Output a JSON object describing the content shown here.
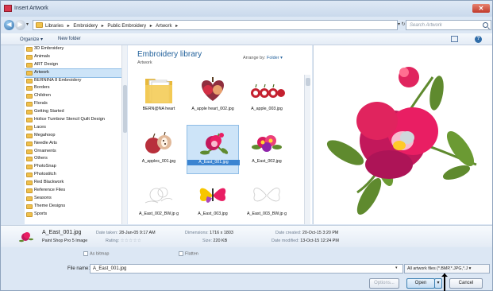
{
  "window": {
    "title": "Insert Artwork",
    "close_glyph": "✕"
  },
  "address": {
    "crumbs": [
      "Libraries",
      "▸",
      "Embroidery",
      "▸",
      "Public Embroidery",
      "▸",
      "Artwork",
      "▸"
    ],
    "dropdown_glyph": "▾",
    "refresh_glyph": "▾ ↻",
    "search_placeholder": "Search Artwork"
  },
  "toolbar": {
    "organize": "Organize ▾",
    "new_folder": "New folder",
    "help_glyph": "?"
  },
  "nav": {
    "items": [
      "3D Embroidery",
      "Animals",
      "ART Design",
      "Artwork",
      "BERNINA 8 Embroidery",
      "Borders",
      "Children",
      "Florals",
      "Getting Started",
      "Holice Turnbow Stencil Quilt Design",
      "Laces",
      "Megahoop",
      "Needle Arts",
      "Ornaments",
      "Others",
      "PhotoSnap",
      "Photostitch",
      "Red Blackwork",
      "Reference Files",
      "Seasons",
      "Theme Designs",
      "Sports"
    ],
    "selected_index": 3
  },
  "library": {
    "title": "Embroidery library",
    "subtitle": "Artwork",
    "arrange_label": "Arrange by:",
    "arrange_value": "Folder ▾"
  },
  "files": [
    {
      "label": "BERN@NA heart",
      "icon": "folder-icon"
    },
    {
      "label": "A_apple heart_002.jpg",
      "icon": "apple-heart-icon"
    },
    {
      "label": "A_apple_003.jpg",
      "icon": "apples-icon"
    },
    {
      "label": "A_apples_001.jpg",
      "icon": "apple-pair-icon"
    },
    {
      "label": "A_East_001.jpg",
      "icon": "flower-icon",
      "selected": true
    },
    {
      "label": "A_East_002.jpg",
      "icon": "bouquet-icon"
    },
    {
      "label": "A_East_002_BW.jp g",
      "icon": "sketch-icon"
    },
    {
      "label": "A_East_003.jpg",
      "icon": "butterfly-icon"
    },
    {
      "label": "A_East_003_BW.jp g",
      "icon": "sketch-icon"
    }
  ],
  "details": {
    "name": "A_East_001.jpg",
    "type": "Paint Shop Pro 5 Image",
    "date_taken_label": "Date taken:",
    "date_taken": "28-Jan-05 9:17 AM",
    "rating_label": "Rating:",
    "rating_stars": "☆☆☆☆☆",
    "dimensions_label": "Dimensions:",
    "dimensions": "1716 x 1803",
    "size_label": "Size:",
    "size": "220 KB",
    "created_label": "Date created:",
    "created": "20-Oct-15 3:20 PM",
    "modified_label": "Date modified:",
    "modified": "13-Oct-15 12:24 PM"
  },
  "options": {
    "as_bitmap": "As bitmap",
    "flatten": "Flatten"
  },
  "file_name": {
    "label": "File name:",
    "value": "A_East_001.jpg",
    "dropdown_glyph": "▾"
  },
  "filter": {
    "value": "All artwork files (*.BMP,*.JPG,*.J ▾"
  },
  "buttons": {
    "options": "Options...",
    "open": "Open",
    "open_drop": "▾",
    "cancel": "Cancel"
  },
  "colors": {
    "accent": "#1f5f9a",
    "selection": "#cde4f8",
    "flower_pink": "#e0245e",
    "leaf_green": "#5f8a2e"
  }
}
